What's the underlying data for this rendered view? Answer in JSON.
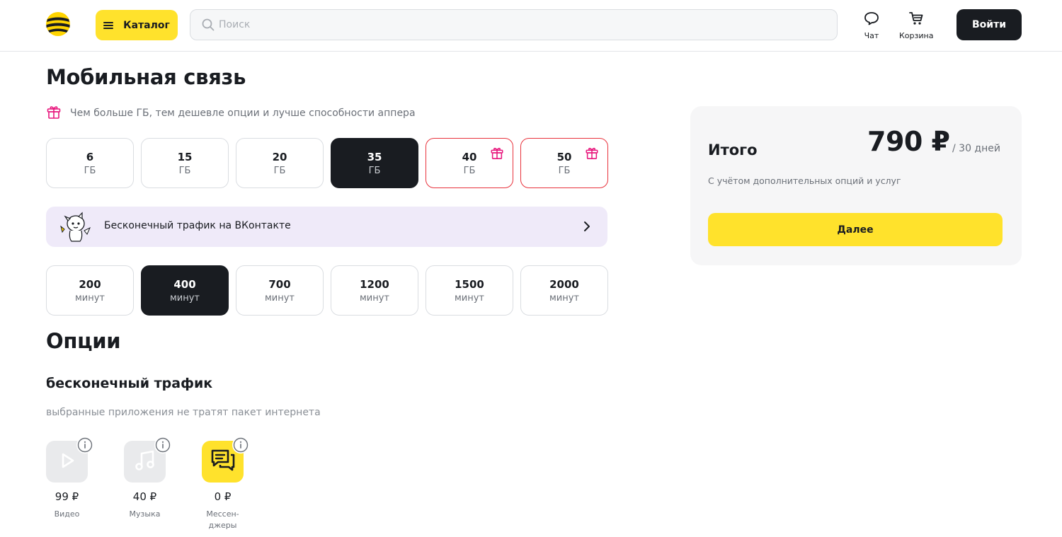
{
  "header": {
    "catalog_label": "Каталог",
    "search_placeholder": "Поиск",
    "search_value": "",
    "chat_label": "Чат",
    "cart_label": "Корзина",
    "login_label": "Войти"
  },
  "main": {
    "title": "Мобильная связь",
    "promo_text": "Чем больше ГБ, тем дешевле опции и лучше способности аппера",
    "data_options": [
      {
        "value": "6",
        "unit": "ГБ",
        "selected": false,
        "gift": false
      },
      {
        "value": "15",
        "unit": "ГБ",
        "selected": false,
        "gift": false
      },
      {
        "value": "20",
        "unit": "ГБ",
        "selected": false,
        "gift": false
      },
      {
        "value": "35",
        "unit": "ГБ",
        "selected": true,
        "gift": false
      },
      {
        "value": "40",
        "unit": "ГБ",
        "selected": false,
        "gift": true
      },
      {
        "value": "50",
        "unit": "ГБ",
        "selected": false,
        "gift": true
      }
    ],
    "vk_banner_text": "Бесконечный трафик на ВКонтакте",
    "minutes_options": [
      {
        "value": "200",
        "unit": "минут",
        "selected": false
      },
      {
        "value": "400",
        "unit": "минут",
        "selected": true
      },
      {
        "value": "700",
        "unit": "минут",
        "selected": false
      },
      {
        "value": "1200",
        "unit": "минут",
        "selected": false
      },
      {
        "value": "1500",
        "unit": "минут",
        "selected": false
      },
      {
        "value": "2000",
        "unit": "минут",
        "selected": false
      }
    ],
    "options_title": "Опции",
    "unlimited_title": "бесконечный трафик",
    "unlimited_desc": "выбранные приложения не тратят пакет интернета",
    "apps": [
      {
        "price": "99 ₽",
        "name": "Видео",
        "icon": "play-icon",
        "active": false
      },
      {
        "price": "40 ₽",
        "name": "Музыка",
        "icon": "music-icon",
        "active": false
      },
      {
        "price": "0 ₽",
        "name": "Мессен-\nджеры",
        "icon": "messenger-icon",
        "active": true
      }
    ]
  },
  "summary": {
    "label": "Итого",
    "price": "790 ₽",
    "period": "/ 30 дней",
    "note": "С учётом дополнительных опций и услуг",
    "next_label": "Далее"
  },
  "colors": {
    "accent_yellow": "#ffe22c",
    "dark": "#191c21",
    "gift_red": "#e8323c",
    "gift_pink": "#e8177d",
    "banner_lavender": "#efeaf9"
  }
}
